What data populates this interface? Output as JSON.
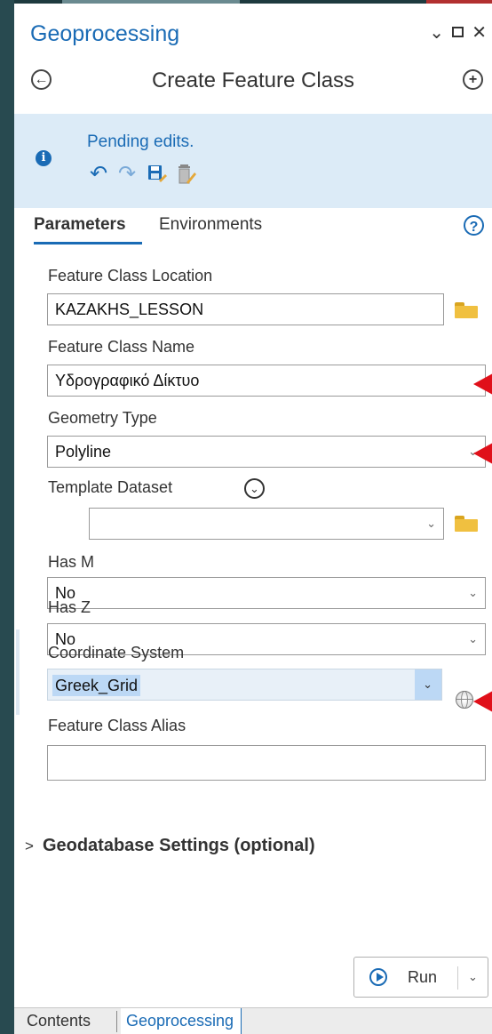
{
  "pane": {
    "title": "Geoprocessing"
  },
  "tool": {
    "title": "Create Feature Class"
  },
  "banner": {
    "message": "Pending edits."
  },
  "tabs": {
    "parameters": "Parameters",
    "environments": "Environments"
  },
  "fields": {
    "location": {
      "label": "Feature Class Location",
      "value": "KAZAKHS_LESSON"
    },
    "name": {
      "label": "Feature Class Name",
      "value": "Υδρογραφικό Δίκτυο"
    },
    "geometry": {
      "label": "Geometry Type",
      "value": "Polyline"
    },
    "template": {
      "label": "Template Dataset",
      "value": ""
    },
    "has_m": {
      "label": "Has M",
      "value": "No"
    },
    "has_z": {
      "label": "Has Z",
      "value": "No"
    },
    "coordinate_system": {
      "label": "Coordinate System",
      "value": "Greek_Grid"
    },
    "alias": {
      "label": "Feature Class Alias",
      "value": ""
    }
  },
  "geodatabase_settings": {
    "label": "Geodatabase Settings (optional)"
  },
  "run": {
    "label": "Run"
  },
  "bottom_tabs": {
    "contents": "Contents",
    "geoprocessing": "Geoprocessing"
  },
  "colors": {
    "accent": "#1a6bb5",
    "banner_bg": "#dcebf7",
    "annotation_arrow": "#e0101a"
  },
  "icons": [
    "back-arrow-icon",
    "add-icon",
    "info-icon",
    "undo-icon",
    "redo-icon",
    "save-edits-icon",
    "discard-edits-icon",
    "help-icon",
    "folder-icon",
    "chevron-down-icon",
    "globe-icon",
    "run-icon"
  ]
}
